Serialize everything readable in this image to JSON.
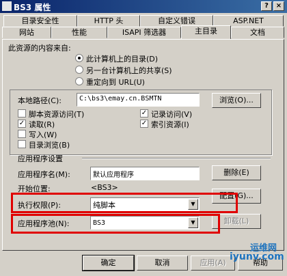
{
  "window": {
    "title": "BS3 属性",
    "help_glyph": "?",
    "close_glyph": "×"
  },
  "tabs_row1": [
    "目录安全性",
    "HTTP 头",
    "自定义错误",
    "ASP.NET"
  ],
  "tabs_row2": [
    "网站",
    "性能",
    "ISAPI 筛选器",
    "主目录",
    "文档"
  ],
  "source": {
    "heading": "此资源的内容来自:",
    "options": [
      "此计算机上的目录(D)",
      "另一台计算机上的共享(S)",
      "重定向到 URL(U)"
    ],
    "selected_index": 0
  },
  "local_path": {
    "label": "本地路径(C):",
    "value": "C:\\bs3\\emay.cn.BSMTN",
    "browse": "浏览(O)..."
  },
  "permissions": {
    "left": [
      {
        "label": "脚本资源访问(T)",
        "checked": false
      },
      {
        "label": "读取(R)",
        "checked": true
      },
      {
        "label": "写入(W)",
        "checked": false
      },
      {
        "label": "目录浏览(B)",
        "checked": false
      }
    ],
    "right": [
      {
        "label": "记录访问(V)",
        "checked": true
      },
      {
        "label": "索引资源(I)",
        "checked": true
      }
    ],
    "check_glyph": "✓"
  },
  "app": {
    "section": "应用程序设置",
    "name_label": "应用程序名(M):",
    "name_value": "默认应用程序",
    "remove": "删除(E)",
    "start_label": "开始位置:",
    "start_value": "<BS3>",
    "exec_label": "执行权限(P):",
    "exec_value": "纯脚本",
    "config": "配置(G)...",
    "pool_label": "应用程序池(N):",
    "pool_value": "BS3",
    "unload": "卸载(L)",
    "arrow_glyph": "▼"
  },
  "buttons": {
    "ok": "确定",
    "cancel": "取消",
    "apply": "应用(A)",
    "help": "帮助"
  },
  "watermark": {
    "brand": "运维网",
    "url": "iyunv.com"
  }
}
